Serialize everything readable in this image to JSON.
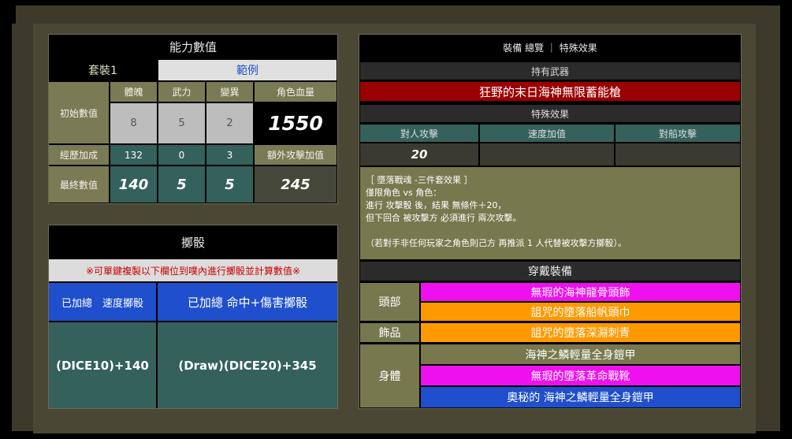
{
  "stats": {
    "title": "能力數值",
    "set_label": "套裝1",
    "example_label": "範例",
    "col_headers": [
      "體魄",
      "武力",
      "變異",
      "角色血量"
    ],
    "rows": [
      {
        "label": "初始數值",
        "values": [
          "8",
          "5",
          "2"
        ],
        "extra": "1550"
      },
      {
        "label": "經歷加成",
        "values": [
          "132",
          "0",
          "3"
        ],
        "extra": "額外攻擊加值"
      },
      {
        "label": "最終數值",
        "values": [
          "140",
          "5",
          "5"
        ],
        "extra": "245"
      }
    ]
  },
  "dice": {
    "title": "擲骰",
    "notice": "※可單鍵複製以下欄位到噗內進行擲骰並計算數值※",
    "col1_header": "已加總　速度擲骰",
    "col2_header": "已加總 命中+傷害擲骰",
    "col1_value": "(DICE10)+140",
    "col2_value": "(Draw)(DICE20)+345"
  },
  "equip": {
    "title": "裝備 總覽 ｜ 特殊效果",
    "weapon_header": "持有武器",
    "weapon_name": "狂野的末日海神無限蓄能槍",
    "effect_header": "特殊效果",
    "effect_cols": [
      "對人攻擊",
      "速度加值",
      "對船攻擊"
    ],
    "effect_values": [
      "20",
      "",
      ""
    ],
    "set_effect_lines": [
      "［ 墮落戰魂 -三件套效果 ］",
      "僅限角色 vs 角色：",
      "進行 攻擊骰 後，結果 無條件＋20，",
      "但下回合 被攻擊方 必須進行 兩次攻擊。",
      "",
      "（若對手非任何玩家之角色則己方 再推派 1 人代替被攻擊方擲骰）。"
    ],
    "worn_header": "穿戴裝備",
    "slots": [
      {
        "label": "頭部",
        "items": [
          {
            "name": "無瑕的海神龍骨頭飾",
            "color": "#ee10ee"
          },
          {
            "name": "詛咒的墮落船帆頭巾",
            "color": "#ff9900"
          }
        ]
      },
      {
        "label": "飾品",
        "items": [
          {
            "name": "詛咒的墮落深淵刺青",
            "color": "#ff9900"
          }
        ]
      },
      {
        "label": "身體",
        "items": [
          {
            "name": "海神之鱗輕量全身鎧甲",
            "color": "#78784f"
          },
          {
            "name": "無瑕的墮落革命戰靴",
            "color": "#ee10ee"
          },
          {
            "name": "奧秘的 海神之鱗輕量全身鎧甲",
            "color": "#1f4fcc"
          }
        ]
      }
    ]
  },
  "colors": {
    "frame": "#3d3a2c",
    "olive": "#7a7a55",
    "teal": "#34615c",
    "weapon_red": "#9b0000",
    "blue": "#1f4fcc",
    "magenta": "#ee10ee",
    "orange": "#ff9900"
  }
}
